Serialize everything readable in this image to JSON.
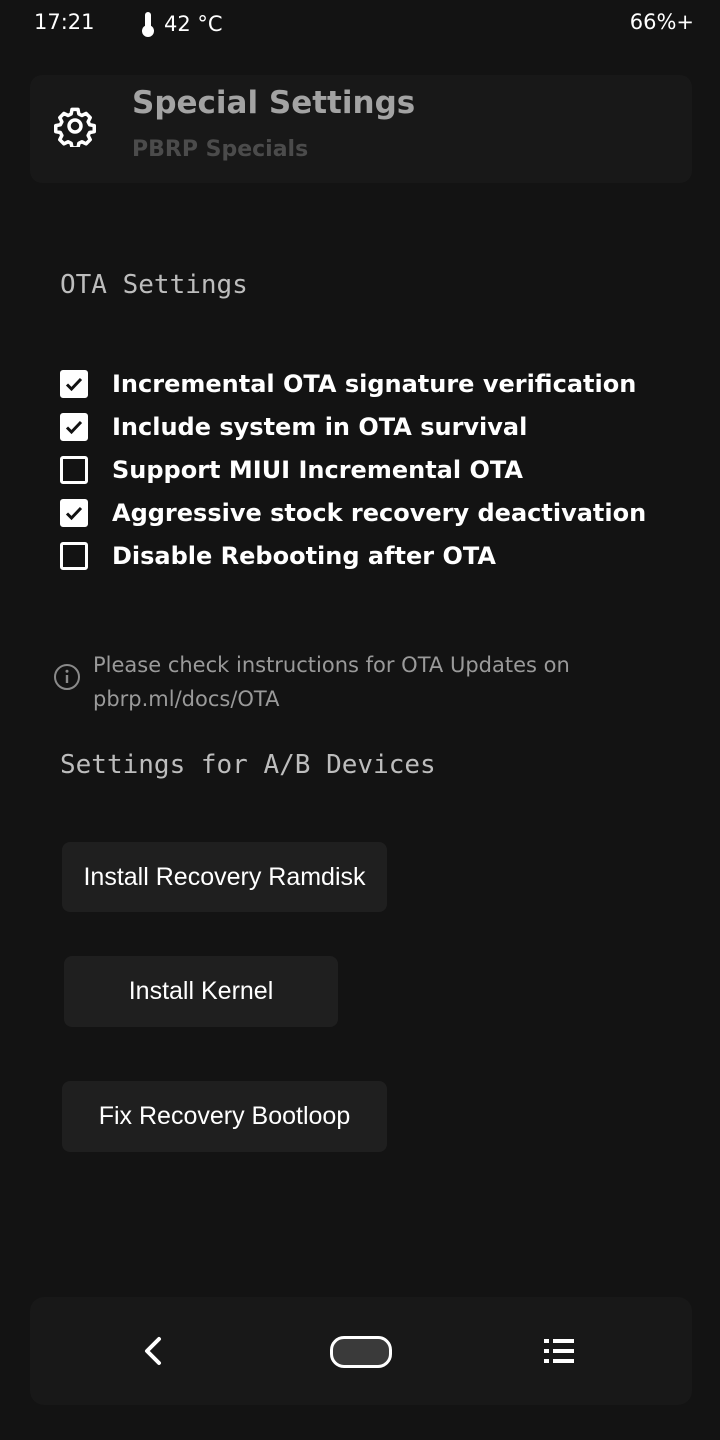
{
  "status_bar": {
    "time": "17:21",
    "temperature": "42 °C",
    "battery": "66%+"
  },
  "header": {
    "icon": "gear-icon",
    "title": "Special Settings",
    "subtitle": "PBRP Specials"
  },
  "ota_section": {
    "title": "OTA Settings",
    "options": [
      {
        "label": "Incremental OTA signature verification",
        "checked": true
      },
      {
        "label": "Include system in OTA survival",
        "checked": true
      },
      {
        "label": "Support MIUI Incremental OTA",
        "checked": false
      },
      {
        "label": "Aggressive stock recovery deactivation",
        "checked": true
      },
      {
        "label": "Disable Rebooting after OTA",
        "checked": false
      }
    ],
    "info_icon": "info-icon",
    "info_text_line1": "Please check instructions for OTA Updates on",
    "info_text_line2": "pbrp.ml/docs/OTA"
  },
  "ab_section": {
    "title": "Settings for A/B Devices",
    "buttons": [
      {
        "label": "Install Recovery Ramdisk"
      },
      {
        "label": "Install Kernel"
      },
      {
        "label": "Fix Recovery Bootloop"
      }
    ]
  },
  "nav_bar": {
    "back_icon": "back-icon",
    "home_icon": "home-icon",
    "menu_icon": "menu-icon"
  }
}
